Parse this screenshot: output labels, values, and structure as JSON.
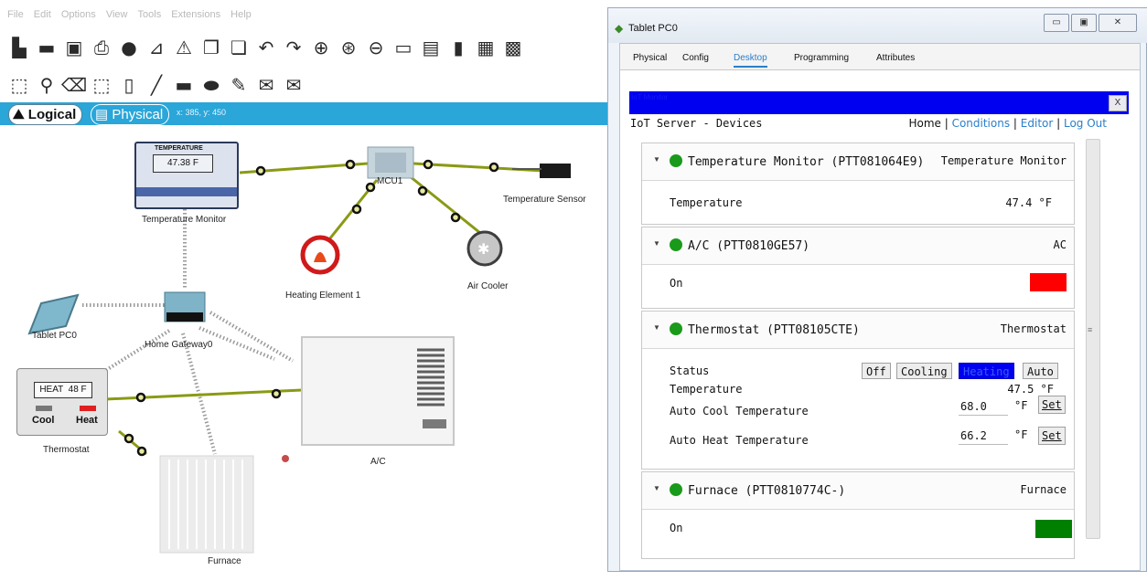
{
  "menubar": [
    "File",
    "Edit",
    "Options",
    "View",
    "Tools",
    "Extensions",
    "Help"
  ],
  "modebar": {
    "logical": "Logical",
    "physical": "Physical",
    "coords": "x: 385, y: 450"
  },
  "canvas": {
    "temperature_monitor": {
      "header": "TEMPERATURE",
      "reading": "47.38 F",
      "label": "Temperature Monitor"
    },
    "mcu_label": "MCU1",
    "temperature_sensor_label": "Temperature Sensor",
    "heating_element_label": "Heating Element 1",
    "air_cooler_label": "Air Cooler",
    "tablet_label": "Tablet PC0",
    "gateway_label": "Home Gateway0",
    "thermostat": {
      "display": "HEAT  48 F",
      "cool": "Cool",
      "heat": "Heat",
      "label": "Thermostat"
    },
    "ac_label": "A/C",
    "furnace_label": "Furnace"
  },
  "window": {
    "title": "Tablet PC0",
    "tabs": [
      "Physical",
      "Config",
      "Desktop",
      "Programming",
      "Attributes"
    ],
    "active_tab": "Desktop",
    "browser_title": "IoT Monitor",
    "close_label": "X",
    "page_title": "IoT Server - Devices",
    "nav": {
      "home": "Home",
      "conditions": "Conditions",
      "editor": "Editor",
      "logout": "Log Out"
    },
    "devices": [
      {
        "name": "Temperature Monitor (PTT081064E9)",
        "type": "Temperature Monitor",
        "rows": [
          {
            "label": "Temperature",
            "value": "47.4 °F"
          }
        ]
      },
      {
        "name": "A/C (PTT0810GE57)",
        "type": "AC",
        "rows": [
          {
            "label": "On",
            "indicator_color": "#ff0000"
          }
        ]
      },
      {
        "name": "Thermostat (PTT08105CTE)",
        "type": "Thermostat",
        "status_label": "Status",
        "status_buttons": [
          "Off",
          "Cooling",
          "Heating",
          "Auto"
        ],
        "active_status": "Heating",
        "temperature_label": "Temperature",
        "temperature_value": "47.5 °F",
        "auto_cool_label": "Auto Cool Temperature",
        "auto_cool_value": "68.0",
        "auto_heat_label": "Auto Heat Temperature",
        "auto_heat_value": "66.2",
        "unit": "°F",
        "set_label": "Set"
      },
      {
        "name": "Furnace (PTT0810774C-)",
        "type": "Furnace",
        "rows": [
          {
            "label": "On",
            "indicator_color": "#008000"
          }
        ]
      }
    ]
  },
  "colors": {
    "modebar": "#2aa6d9",
    "link": "#2a7ec9",
    "online_dot": "#1a9a1a",
    "heating_active": "#0000f0",
    "ac_on": "#ff0000",
    "furnace_on": "#008000"
  }
}
